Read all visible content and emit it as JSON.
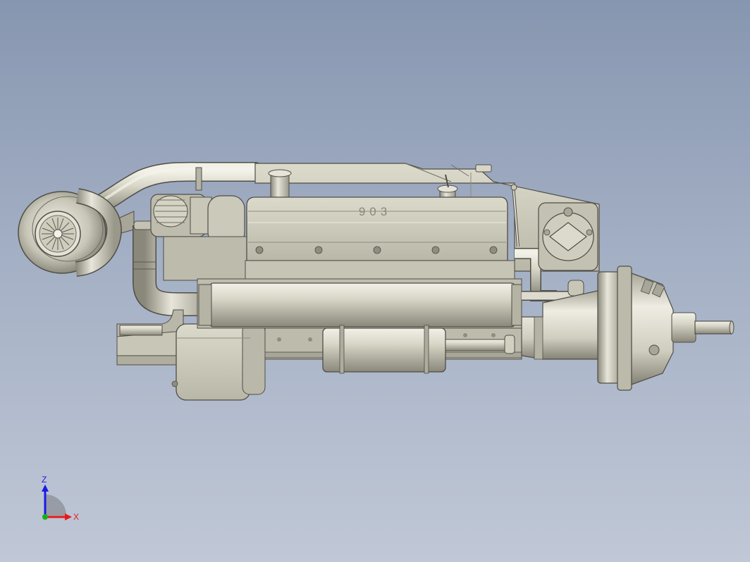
{
  "model": {
    "cover_marking": "903"
  },
  "triad": {
    "z_label": "Z",
    "x_label": "X",
    "z_color": "#1a1ae6",
    "x_color": "#e61a1a",
    "y_color": "#18b018"
  },
  "colors": {
    "background_top": "#8796b0",
    "background_bottom": "#c0c8d6",
    "metal_light": "#d8d6c8",
    "metal_mid": "#c2c0b0",
    "metal_dark": "#8f8d7e",
    "metal_edge": "#4f4e46"
  }
}
